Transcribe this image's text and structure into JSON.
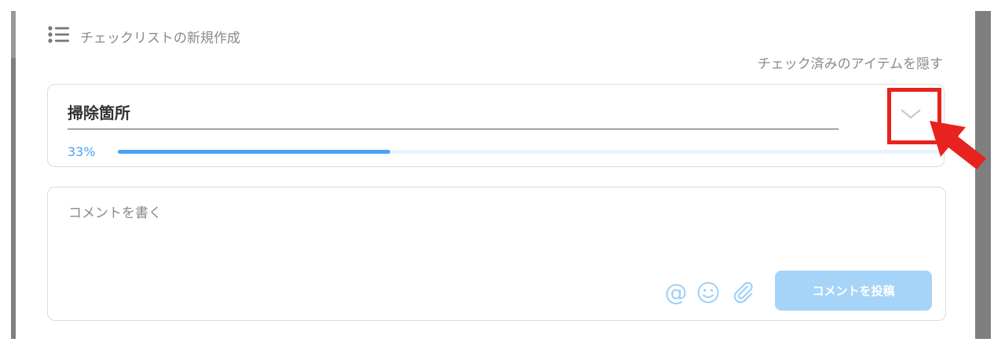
{
  "header": {
    "new_checklist_label": "チェックリストの新規作成",
    "hide_checked_label": "チェック済みのアイテムを隠す"
  },
  "checklist": {
    "title": "掃除箇所",
    "progress_text": "33%",
    "progress_value": 0.33
  },
  "comment": {
    "placeholder": "コメントを書く",
    "value": "",
    "post_button_label": "コメントを投稿",
    "mention_symbol": "@"
  },
  "icons": [
    "list-icon",
    "chevron-down-icon",
    "at-icon",
    "smiley-icon",
    "paperclip-icon",
    "red-arrow-icon"
  ],
  "colors": {
    "accent": "#4aa3f0",
    "button_disabled": "#a6d4f8",
    "highlight": "#e8231f"
  }
}
